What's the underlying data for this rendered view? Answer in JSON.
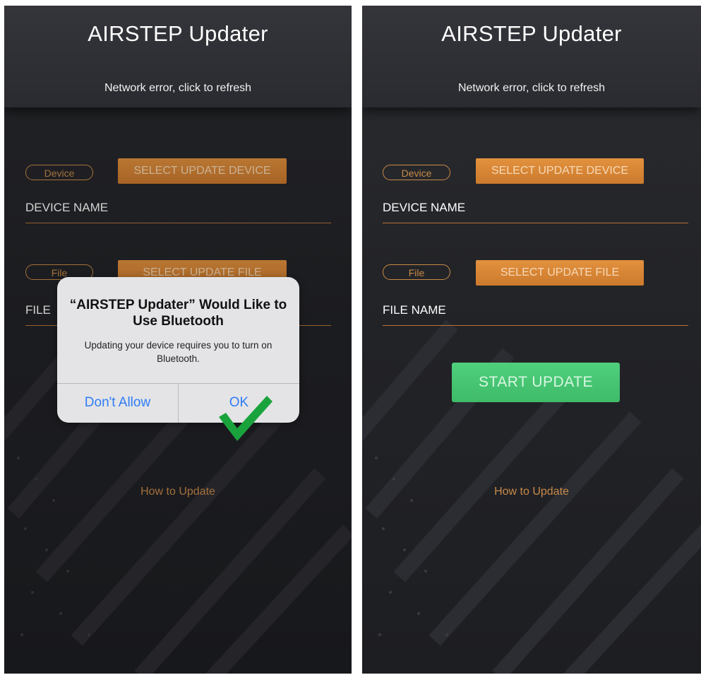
{
  "left_screen": {
    "title": "AIRSTEP Updater",
    "network_status": "Network error, click to refresh",
    "device_pill": "Device",
    "select_device_button": "SELECT UPDATE DEVICE",
    "device_name_label": "DEVICE NAME",
    "file_pill": "File",
    "select_file_button": "SELECT UPDATE FILE",
    "file_name_label": "FILE",
    "how_to_update": "How to Update",
    "alert": {
      "title": "“AIRSTEP  Updater” Would Like to Use Bluetooth",
      "message": "Updating your device requires you to turn on Bluetooth.",
      "deny_button": "Don't Allow",
      "ok_button": "OK"
    },
    "annotation_icon": "green-checkmark-icon"
  },
  "right_screen": {
    "title": "AIRSTEP Updater",
    "network_status": "Network error, click to refresh",
    "device_pill": "Device",
    "select_device_button": "SELECT UPDATE DEVICE",
    "device_name_label": "DEVICE NAME",
    "file_pill": "File",
    "select_file_button": "SELECT UPDATE FILE",
    "file_name_label": "FILE NAME",
    "start_update_button": "START UPDATE",
    "how_to_update": "How to Update"
  },
  "colors": {
    "background": "#232428",
    "accent_orange": "#d8873a",
    "start_green": "#46c471",
    "ios_blue": "#2e7cf6",
    "checkmark_green": "#1aa33c"
  }
}
